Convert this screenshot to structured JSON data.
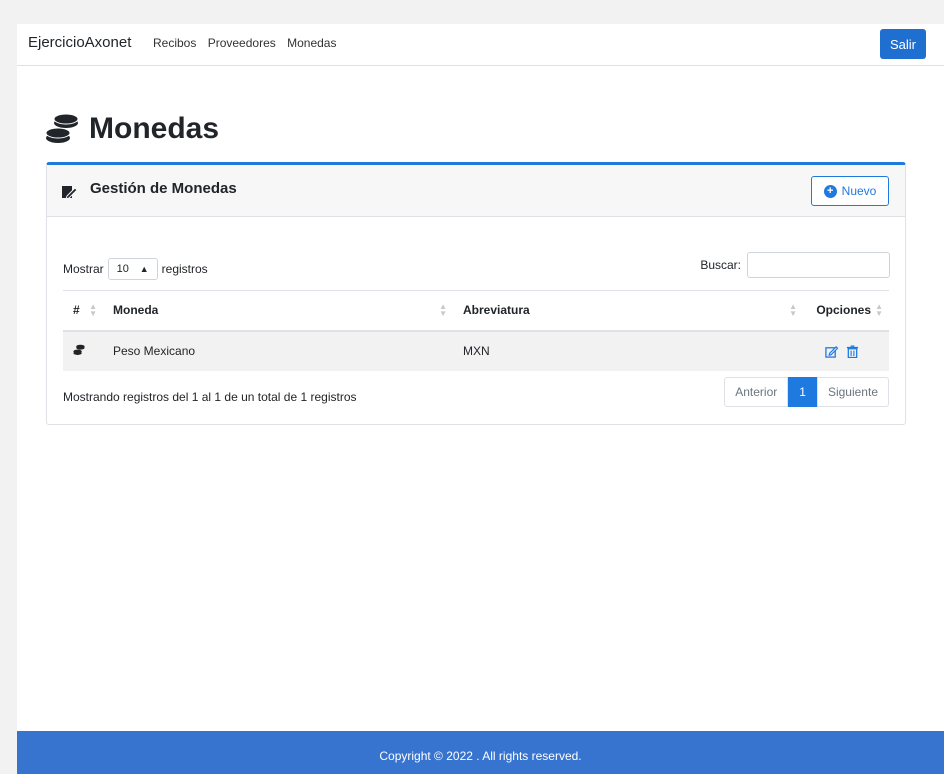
{
  "nav": {
    "brand": "EjercicioAxonet",
    "links": [
      "Recibos",
      "Proveedores",
      "Monedas"
    ],
    "logout_label": "Salir"
  },
  "page": {
    "title": "Monedas"
  },
  "card": {
    "header_title": "Gestión de Monedas",
    "new_button_label": "Nuevo"
  },
  "table_controls": {
    "show_label": "Mostrar",
    "length_value": "10",
    "records_label": "registros",
    "search_label": "Buscar:",
    "search_value": ""
  },
  "table": {
    "columns": [
      "#",
      "Moneda",
      "Abreviatura",
      "Opciones"
    ],
    "rows": [
      {
        "moneda": "Peso Mexicano",
        "abreviatura": "MXN"
      }
    ]
  },
  "footer_info": "Mostrando registros del 1 al 1 de un total de 1 registros",
  "pagination": {
    "prev_label": "Anterior",
    "current_page": "1",
    "next_label": "Siguiente"
  },
  "footer": {
    "copyright": "Copyright © 2022 . All rights reserved."
  },
  "colors": {
    "primary": "#1f7ae0",
    "footer_bg": "#3674d0"
  }
}
